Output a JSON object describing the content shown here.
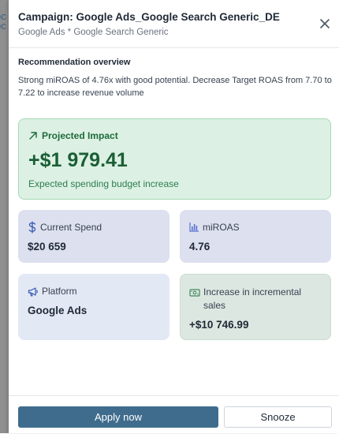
{
  "backdrop": {
    "text": "oc oc"
  },
  "header": {
    "title": "Campaign: Google Ads_Google Search Generic_DE",
    "subtitle": "Google Ads * Google Search Generic",
    "close_icon": "close-icon"
  },
  "overview": {
    "title": "Recommendation overview",
    "text": "Strong miROAS of 4.76x with good potential. Decrease Target ROAS from 7.70 to 7.22 to increase revenue volume"
  },
  "impact": {
    "title": "Projected Impact",
    "value": "+$1 979.41",
    "description": "Expected spending budget increase",
    "icon": "arrow-up-right-icon",
    "color": "#1e6a3c"
  },
  "cards": {
    "current_spend": {
      "label": "Current Spend",
      "value": "$20 659",
      "icon": "dollar-icon"
    },
    "miroas": {
      "label": "miROAS",
      "value": "4.76",
      "icon": "bar-chart-icon"
    },
    "platform": {
      "label": "Platform",
      "value": "Google Ads",
      "icon": "megaphone-icon"
    },
    "incremental_sales": {
      "label": "Increase in incremental sales",
      "value": "+$10 746.99",
      "icon": "banknote-icon"
    }
  },
  "footer": {
    "apply_label": "Apply now",
    "snooze_label": "Snooze",
    "apply_color": "#3f6c8d"
  }
}
